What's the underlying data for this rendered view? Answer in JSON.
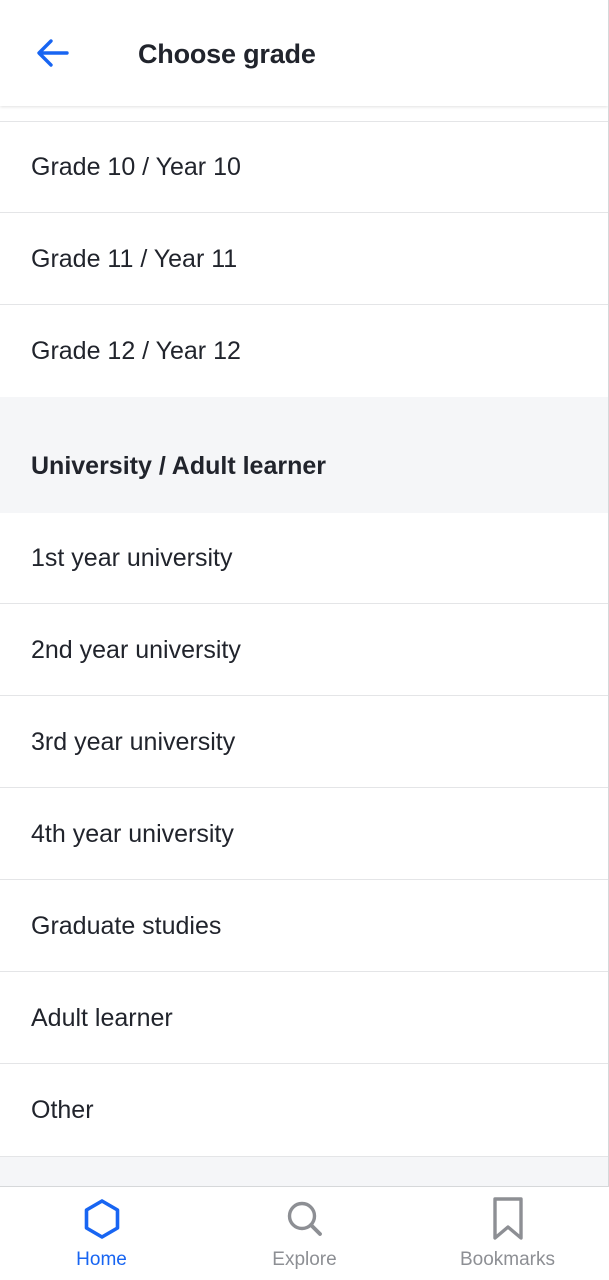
{
  "header": {
    "title": "Choose grade",
    "back_icon": "arrow-left-icon"
  },
  "grade_items": [
    {
      "label": "Grade 10 / Year 10"
    },
    {
      "label": "Grade 11 / Year 11"
    },
    {
      "label": "Grade 12 / Year 12"
    }
  ],
  "section": {
    "title": "University / Adult learner"
  },
  "university_items": [
    {
      "label": "1st year university"
    },
    {
      "label": "2nd year university"
    },
    {
      "label": "3rd year university"
    },
    {
      "label": "4th year university"
    },
    {
      "label": "Graduate studies"
    },
    {
      "label": "Adult learner"
    },
    {
      "label": "Other"
    }
  ],
  "bottom_nav": {
    "items": [
      {
        "label": "Home",
        "icon": "hexagon-home-icon",
        "active": true
      },
      {
        "label": "Explore",
        "icon": "search-icon",
        "active": false
      },
      {
        "label": "Bookmarks",
        "icon": "bookmark-icon",
        "active": false
      }
    ]
  },
  "colors": {
    "accent": "#1865f2",
    "text": "#21242c",
    "inactive": "#8d8f94",
    "section_bg": "#f5f6f8"
  }
}
